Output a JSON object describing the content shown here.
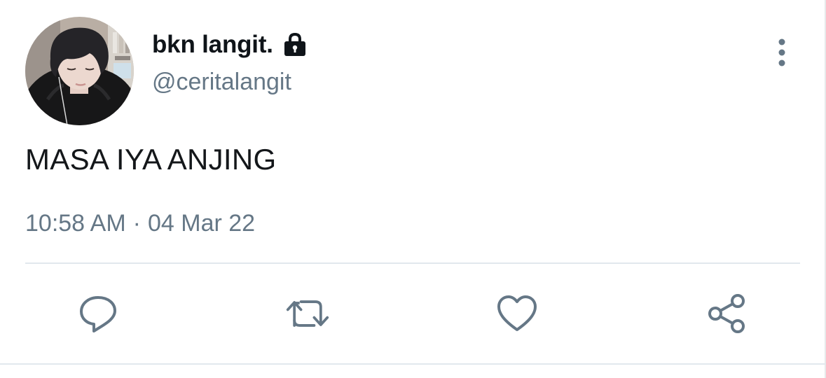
{
  "user": {
    "display_name": "bkn langit.",
    "handle": "@ceritalangit",
    "protected": true,
    "avatar": "avatar-photo",
    "lock_icon": "lock-icon"
  },
  "tweet": {
    "text": "MASA IYA ANJING",
    "time": "10:58 AM",
    "separator": "·",
    "date": "04 Mar 22"
  },
  "actions": [
    {
      "name": "reply",
      "icon": "reply-icon"
    },
    {
      "name": "retweet",
      "icon": "retweet-icon"
    },
    {
      "name": "like",
      "icon": "heart-icon"
    },
    {
      "name": "share",
      "icon": "share-icon"
    }
  ],
  "menu": {
    "icon": "more-vertical-icon"
  },
  "colors": {
    "text_primary": "#0f1419",
    "text_secondary": "#657786",
    "icon": "#657786",
    "divider": "#e1e8ed",
    "background": "#ffffff"
  }
}
